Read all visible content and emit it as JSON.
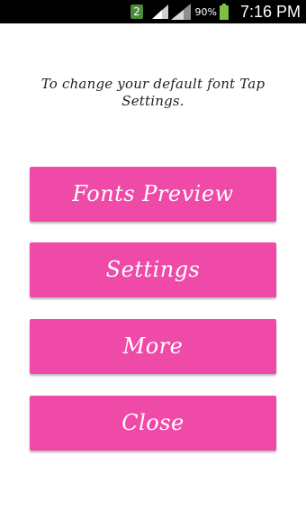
{
  "status_bar": {
    "notification_count": "2",
    "battery_percent": "90%",
    "time": "7:16 PM",
    "icons": [
      "notification-badge-icon",
      "signal-icon",
      "signal-icon",
      "battery-icon"
    ]
  },
  "main": {
    "instruction": "To change your default font Tap Settings.",
    "buttons": [
      {
        "label": "Fonts Preview"
      },
      {
        "label": "Settings"
      },
      {
        "label": "More"
      },
      {
        "label": "Close"
      }
    ]
  },
  "colors": {
    "button_bg": "#f04aa8",
    "button_text": "#ffffff",
    "status_bar_bg": "#000000",
    "battery_fill": "#7ec142"
  }
}
